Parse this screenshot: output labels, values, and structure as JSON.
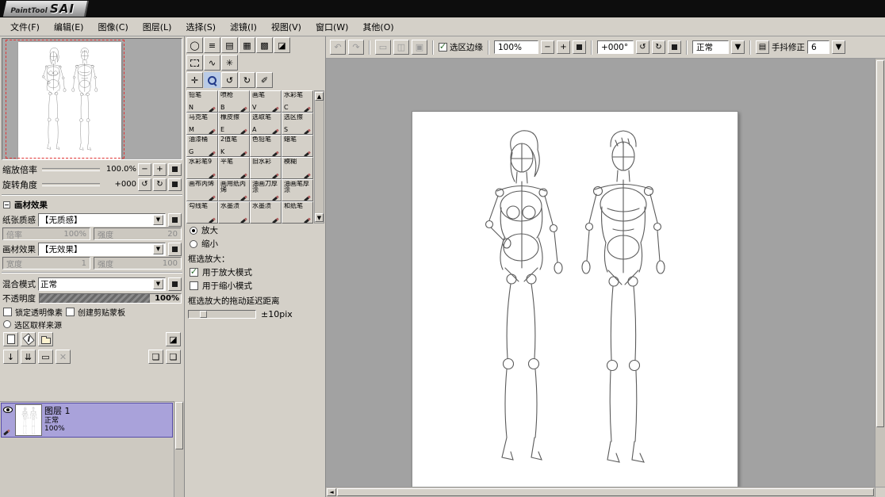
{
  "titlebar": {
    "logo_small": "PaintTool",
    "logo_big": "SAI"
  },
  "menubar": {
    "items": [
      "文件(F)",
      "编辑(E)",
      "图像(C)",
      "图层(L)",
      "选择(S)",
      "滤镜(I)",
      "视图(V)",
      "窗口(W)",
      "其他(O)"
    ]
  },
  "toolbar": {
    "selection_edge_label": "选区边缘",
    "zoom_value": "100%",
    "angle_value": "+000°",
    "blend_value": "正常",
    "stabilizer_label": "手抖修正",
    "stabilizer_value": "6"
  },
  "navigator": {
    "zoom_label": "缩放倍率",
    "zoom_value": "100.0%",
    "rotation_label": "旋转角度",
    "rotation_value": "+000"
  },
  "material": {
    "section_title": "画材效果",
    "paper_label": "纸张质感",
    "paper_value": "【无质感】",
    "paper_scale_label": "倍率",
    "paper_scale_value": "100%",
    "paper_strength_label": "强度",
    "paper_strength_value": "20",
    "effect_label": "画材效果",
    "effect_value": "【无效果】",
    "effect_width_label": "宽度",
    "effect_width_value": "1",
    "effect_strength_label": "强度",
    "effect_strength_value": "100"
  },
  "layer_props": {
    "blend_label": "混合模式",
    "blend_value": "正常",
    "opacity_label": "不透明度",
    "opacity_value": "100%",
    "lock_alpha_label": "锁定透明像素",
    "clipping_label": "创建剪贴蒙板",
    "selection_source_label": "选区取样来源"
  },
  "layers": {
    "name": "图层 1",
    "mode": "正常",
    "opacity": "100%"
  },
  "brushes": {
    "items": [
      {
        "name": "铅笔",
        "key": "N"
      },
      {
        "name": "喷枪",
        "key": "B"
      },
      {
        "name": "画笔",
        "key": "V"
      },
      {
        "name": "水彩笔",
        "key": "C"
      },
      {
        "name": "马克笔",
        "key": "M"
      },
      {
        "name": "橡皮擦",
        "key": "E"
      },
      {
        "name": "选取笔",
        "key": "A"
      },
      {
        "name": "选区擦",
        "key": "S"
      },
      {
        "name": "油漆桶",
        "key": "G"
      },
      {
        "name": "2值笔",
        "key": "K"
      },
      {
        "name": "色铅笔",
        "key": ""
      },
      {
        "name": "蜡笔",
        "key": ""
      },
      {
        "name": "水彩笔9",
        "key": ""
      },
      {
        "name": "平笔",
        "key": ""
      },
      {
        "name": "旧水彩",
        "key": ""
      },
      {
        "name": "模糊",
        "key": ""
      },
      {
        "name": "画布丙烯",
        "key": ""
      },
      {
        "name": "画用纸丙烯",
        "key": ""
      },
      {
        "name": "油画刀厚涂",
        "key": ""
      },
      {
        "name": "油画笔厚涂",
        "key": ""
      },
      {
        "name": "勾线笔",
        "key": ""
      },
      {
        "name": "水墨渍",
        "key": ""
      },
      {
        "name": "水墨渍",
        "key": ""
      },
      {
        "name": "和纸笔",
        "key": ""
      }
    ]
  },
  "zoom_options": {
    "zoom_in": "放大",
    "zoom_out": "缩小",
    "marquee_title": "框选放大：",
    "use_zoom_in": "用于放大模式",
    "use_zoom_out": "用于缩小模式",
    "delay_label": "框选放大的拖动延迟距离",
    "delay_value": "±10pix"
  },
  "colors": {
    "foreground": "#000000",
    "background_swatch": "#2ea23c",
    "selection_dash": "#e03434",
    "layer_selected": "#a9a2da"
  }
}
